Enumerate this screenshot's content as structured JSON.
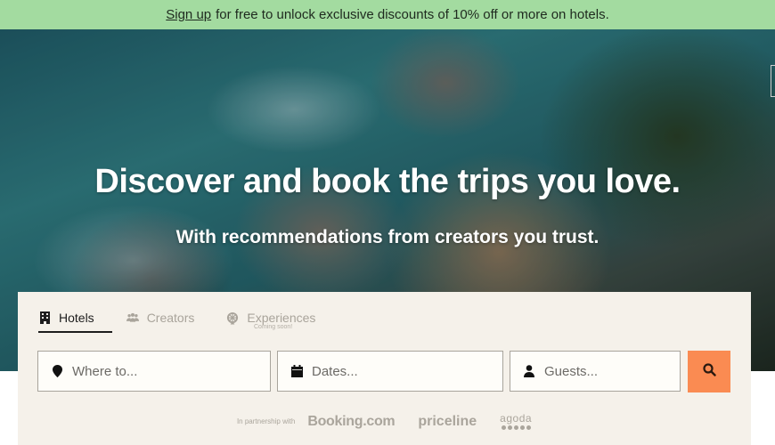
{
  "banner": {
    "link_label": "Sign up",
    "text": "for free to unlock exclusive discounts of 10% off or more on hotels.",
    "background": "#a3dba0"
  },
  "hero": {
    "title": "Discover and book the trips you love.",
    "subtitle": "With recommendations from creators you trust."
  },
  "search": {
    "tabs": [
      {
        "label": "Hotels",
        "icon": "building-icon",
        "active": true
      },
      {
        "label": "Creators",
        "icon": "people-group-icon",
        "active": false
      },
      {
        "label": "Experiences",
        "icon": "ferris-wheel-icon",
        "active": false,
        "note": "Coming soon!"
      }
    ],
    "fields": {
      "where": {
        "placeholder": "Where to...",
        "icon": "map-pin-icon"
      },
      "dates": {
        "placeholder": "Dates...",
        "icon": "calendar-icon"
      },
      "guests": {
        "placeholder": "Guests...",
        "icon": "person-icon"
      }
    },
    "search_button": {
      "icon": "search-icon",
      "color": "#fa8b52"
    }
  },
  "partners": {
    "label": "In partnership with",
    "logos": [
      "Booking.com",
      "priceline",
      "agoda"
    ]
  }
}
